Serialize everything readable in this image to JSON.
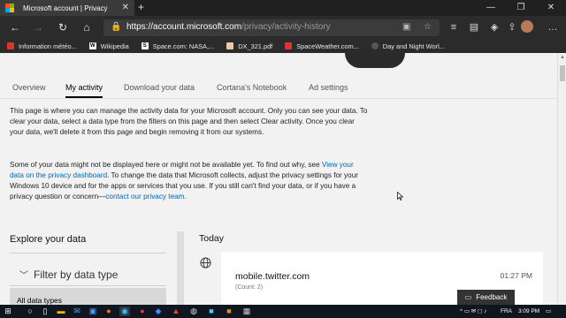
{
  "browser": {
    "tab_title": "Microsoft account | Privacy",
    "tab_close": "✕",
    "new_tab": "+",
    "window_controls": [
      "—",
      "❐",
      "✕"
    ],
    "url_host": "https://account.microsoft.com",
    "url_path": "/privacy/activity-history",
    "favorites": [
      {
        "label": "Information météo...",
        "icon": "weather-icon",
        "color": "#d33"
      },
      {
        "label": "Wikipedia",
        "icon": "wikipedia-icon",
        "color": "#fff",
        "glyph": "W"
      },
      {
        "label": "Space.com: NASA,...",
        "icon": "space-icon",
        "color": "#fff",
        "glyph": "S"
      },
      {
        "label": "DX_321.pdf",
        "icon": "pdf-icon",
        "color": "#e8c9a0"
      },
      {
        "label": "SpaceWeather.com...",
        "icon": "spaceweather-icon",
        "color": "#d33"
      },
      {
        "label": "Day and Night Worl...",
        "icon": "world-icon",
        "color": "#333"
      }
    ]
  },
  "page": {
    "tabs": [
      {
        "label": "Overview",
        "active": false
      },
      {
        "label": "My activity",
        "active": true
      },
      {
        "label": "Download your data",
        "active": false
      },
      {
        "label": "Cortana's Notebook",
        "active": false
      },
      {
        "label": "Ad settings",
        "active": false
      }
    ],
    "intro": "This page is where you can manage the activity data for your Microsoft account. Only you can see your data. To clear your data, select a data type from the filters on this page and then select Clear activity. Once you clear your data, we'll delete it from this page and begin removing it from our systems.",
    "note_before_link": "Some of your data might not be displayed here or might not be available yet. To find out why, see ",
    "note_link1": "View your data on the privacy dashboard",
    "note_middle": ". To change the data that Microsoft collects, adjust the privacy settings for your Windows 10 device and for the apps or services that you use. If you still can't find your data, or if you have a privacy question or concern—",
    "note_link2": "contact our privacy team",
    "note_end": ".",
    "explore_title": "Explore your data",
    "filter_label": "Filter by data type",
    "filter_selected": "All data types",
    "today_label": "Today",
    "activity": {
      "title": "mobile.twitter.com",
      "count": "(Count: 2)",
      "time": "01:27 PM"
    },
    "feedback_label": "Feedback"
  },
  "taskbar": {
    "lang": "FRA",
    "time": "3:09 PM"
  },
  "colors": {
    "link": "#0067b8",
    "taskbar": "#10161f",
    "browser_chrome": "#2b2b2b"
  }
}
